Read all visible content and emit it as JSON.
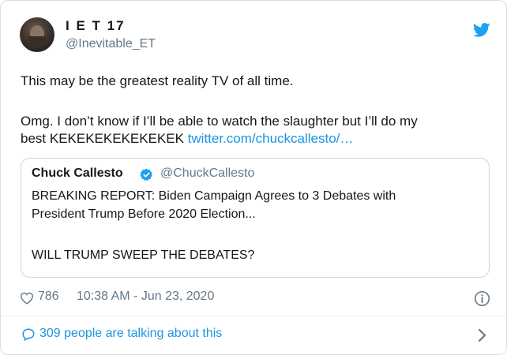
{
  "tweet": {
    "author_name": "I E T 17",
    "author_handle": "@Inevitable_ET",
    "text_line1": "This may be the greatest reality TV of all time.",
    "text_line2": "Omg. I don’t know if I’ll be able to watch the slaughter but I’ll do my",
    "text_line3_prefix": "best KEKEKEKEKEKEKEK ",
    "text_link": "twitter.com/chuckcallesto/…",
    "likes": "786",
    "timestamp": "10:38 AM - Jun 23, 2020",
    "talking": "309 people are talking about this"
  },
  "quoted_tweet": {
    "author_name": "Chuck Callesto",
    "author_handle": "@ChuckCallesto",
    "line1": "BREAKING REPORT: Biden Campaign Agrees to 3 Debates with",
    "line2": "President Trump Before 2020 Election...",
    "line3": "WILL TRUMP SWEEP THE DEBATES?"
  },
  "colors": {
    "link_blue": "#1b95e0",
    "secondary_gray": "#657786",
    "text_dark": "#14171a",
    "border": "#ccd6dd"
  },
  "icons": [
    "avatar",
    "twitter-bird-icon",
    "verified-badge-icon",
    "heart-icon",
    "info-icon",
    "speech-bubble-icon",
    "chevron-right-icon"
  ]
}
